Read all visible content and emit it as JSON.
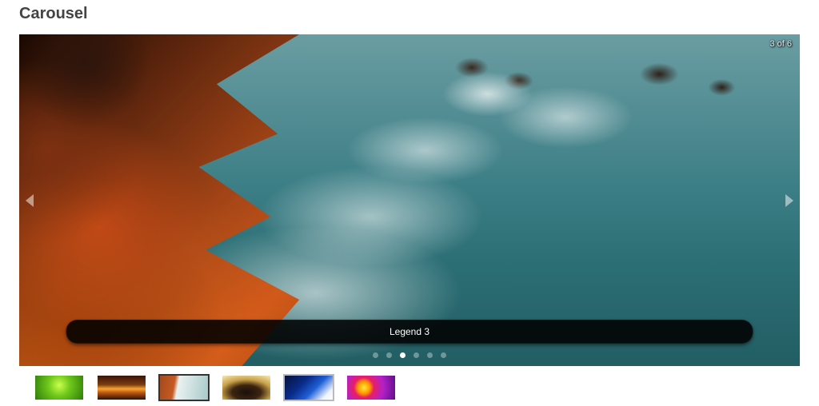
{
  "title": "Carousel",
  "carousel": {
    "current_index": 3,
    "total": 6,
    "counter_text": "3 of 6",
    "caption": "Legend 3",
    "dots": [
      {
        "active": false
      },
      {
        "active": false
      },
      {
        "active": true
      },
      {
        "active": false
      },
      {
        "active": false
      },
      {
        "active": false
      }
    ],
    "thumbnails": [
      {
        "name": "green-grass",
        "selected": false
      },
      {
        "name": "sunset",
        "selected": false
      },
      {
        "name": "rocky-coast",
        "selected": true
      },
      {
        "name": "lone-tree",
        "selected": false
      },
      {
        "name": "blue-sky-beams",
        "selected": false
      },
      {
        "name": "purple-flower",
        "selected": false
      }
    ]
  }
}
